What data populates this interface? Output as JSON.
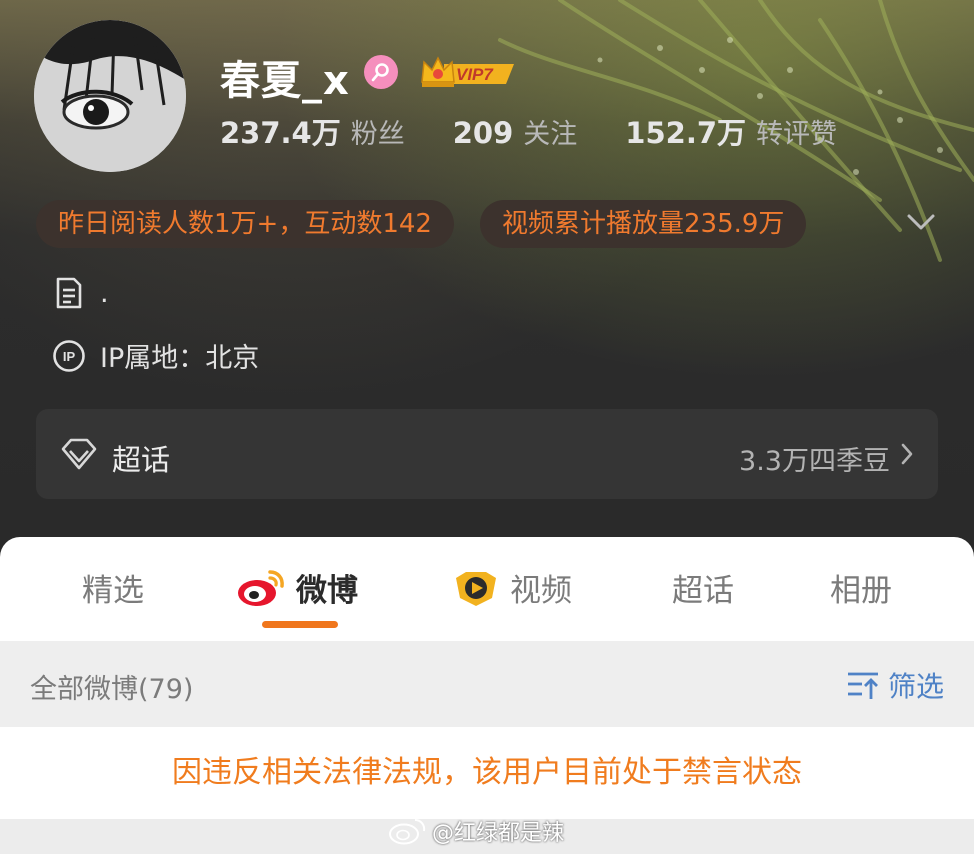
{
  "profile": {
    "username": "春夏_x",
    "vip_label": "VIP7",
    "stats": [
      {
        "value": "237.4万",
        "label": "粉丝"
      },
      {
        "value": "209",
        "label": "关注"
      },
      {
        "value": "152.7万",
        "label": "转评赞"
      }
    ],
    "highlights": [
      "昨日阅读人数1万+，互动数142",
      "视频累计播放量235.9万"
    ],
    "bio": ".",
    "ip_location": "IP属地：北京"
  },
  "supertopic_card": {
    "title": "超话",
    "right_text": "3.3万四季豆"
  },
  "tabs": [
    {
      "label": "精选",
      "active": false
    },
    {
      "label": "微博",
      "active": true
    },
    {
      "label": "视频",
      "active": false
    },
    {
      "label": "超话",
      "active": false
    },
    {
      "label": "相册",
      "active": false
    }
  ],
  "feed": {
    "count_label": "全部微博(79)",
    "filter_label": "筛选",
    "notice": "因违反相关法律法规，该用户目前处于禁言状态"
  },
  "watermark": "@红绿都是辣",
  "colors": {
    "accent_orange": "#f0761c",
    "filter_blue": "#4f82c6",
    "gender_pink": "#f58fbd",
    "vip_gold": "#f2b21f"
  },
  "icons": [
    "female-gender-icon",
    "vip-crown-icon",
    "chevron-down-icon",
    "document-icon",
    "ip-icon",
    "diamond-icon",
    "chevron-right-icon",
    "weibo-logo-icon",
    "video-badge-icon",
    "sort-filter-icon",
    "weibo-watermark-icon"
  ]
}
